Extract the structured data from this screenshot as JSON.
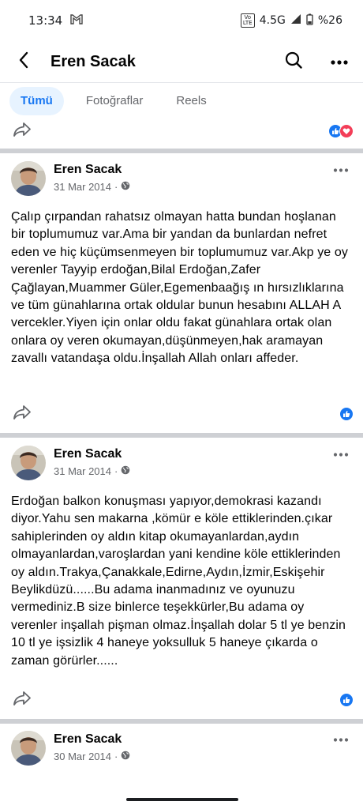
{
  "status_bar": {
    "time": "13:34",
    "network": "4.5G",
    "battery": "%26",
    "volte_top": "Vo",
    "volte_bottom": "LTE"
  },
  "header": {
    "title": "Eren Sacak"
  },
  "tabs": [
    {
      "label": "Tümü",
      "active": true
    },
    {
      "label": "Fotoğraflar",
      "active": false
    },
    {
      "label": "Reels",
      "active": false
    }
  ],
  "posts": [
    {
      "author": "Eren Sacak",
      "date": "31 Mar 2014",
      "separator": "·",
      "text": "Çalıp çırpandan rahatsız olmayan hatta bundan hoşlanan bir toplumumuz var.Ama bir yandan da bunlardan nefret eden ve hiç küçümsenmeyen bir toplumumuz var.Akp ye oy verenler Tayyip erdoğan,Bilal Erdoğan,Zafer Çağlayan,Muammer Güler,Egemenbaağış ın hırsızlıklarına ve tüm günahlarına ortak oldular bunun hesabını ALLAH A vercekler.Yiyen için onlar oldu fakat günahlara ortak olan onlara oy veren okumayan,düşünmeyen,hak aramayan zavallı vatandaşa oldu.İnşallah Allah onları affeder."
    },
    {
      "author": "Eren Sacak",
      "date": "31 Mar 2014",
      "separator": "·",
      "text": "Erdoğan balkon konuşması yapıyor,demokrasi kazandı diyor.Yahu sen makarna ,kömür e köle ettiklerinden.çıkar sahiplerinden oy aldın kitap okumayanlardan,aydın olmayanlardan,varoşlardan yani kendine köle ettiklerinden oy aldın.Trakya,Çanakkale,Edirne,Aydın,İzmir,Eskişehir Beylikdüzü......Bu adama inanmadınız ve oyunuzu vermediniz.B size binlerce teşekkürler,Bu adama oy verenler inşallah pişman olmaz.İnşallah dolar 5 tl ye benzin 10 tl ye işsizlik 4 haneye yoksulluk 5 haneye çıkarda o zaman görürler......"
    },
    {
      "author": "Eren Sacak",
      "date": "30 Mar 2014",
      "separator": "·"
    }
  ],
  "colors": {
    "accent": "#1877f2",
    "love": "#f33e58",
    "divider": "#ced0d4",
    "secondary_text": "#65676b"
  },
  "icons": {
    "back": "arrow-left-icon",
    "search": "search-icon",
    "more": "more-horizontal-icon",
    "share": "share-icon",
    "like": "like-reaction-icon",
    "love": "love-reaction-icon",
    "privacy": "globe-icon"
  }
}
